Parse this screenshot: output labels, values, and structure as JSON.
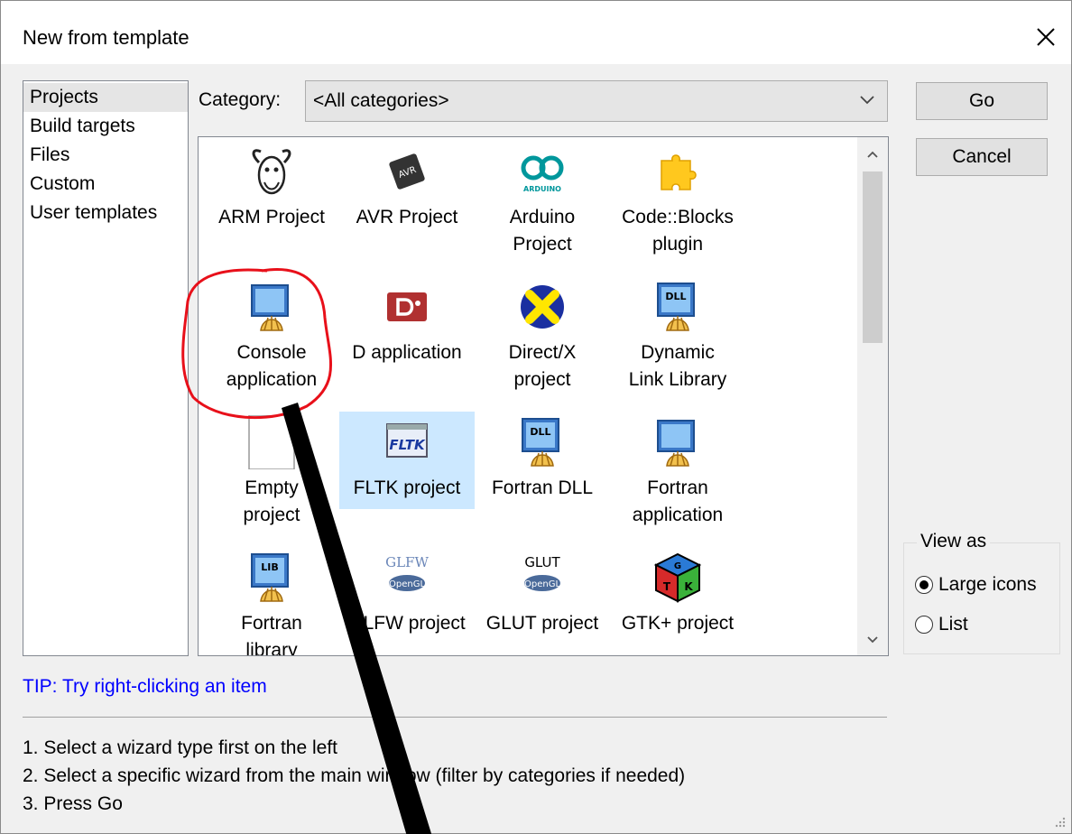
{
  "window": {
    "title": "New from template"
  },
  "sidebar": {
    "items": [
      {
        "label": "Projects",
        "selected": true
      },
      {
        "label": "Build targets"
      },
      {
        "label": "Files"
      },
      {
        "label": "Custom"
      },
      {
        "label": "User templates"
      }
    ]
  },
  "category": {
    "label": "Category:",
    "value": "<All categories>"
  },
  "buttons": {
    "go": "Go",
    "cancel": "Cancel"
  },
  "templates": [
    {
      "line1": "ARM Project",
      "line2": "",
      "icon": "gnu-icon"
    },
    {
      "line1": "AVR Project",
      "line2": "",
      "icon": "avr-chip-icon"
    },
    {
      "line1": "Arduino",
      "line2": "Project",
      "icon": "arduino-icon"
    },
    {
      "line1": "Code::Blocks",
      "line2": "plugin",
      "icon": "puzzle-piece-icon"
    },
    {
      "line1": "Console",
      "line2": "application",
      "icon": "console-app-icon"
    },
    {
      "line1": "D application",
      "line2": "",
      "icon": "d-language-icon"
    },
    {
      "line1": "Direct/X",
      "line2": "project",
      "icon": "directx-icon"
    },
    {
      "line1": "Dynamic",
      "line2": "Link Library",
      "icon": "dll-icon"
    },
    {
      "line1": "Empty",
      "line2": "project",
      "icon": "empty-file-icon"
    },
    {
      "line1": "FLTK project",
      "line2": "",
      "icon": "fltk-icon",
      "selected": true
    },
    {
      "line1": "Fortran DLL",
      "line2": "",
      "icon": "fortran-dll-icon"
    },
    {
      "line1": "Fortran",
      "line2": "application",
      "icon": "fortran-app-icon"
    },
    {
      "line1": "Fortran",
      "line2": "library",
      "icon": "lib-icon"
    },
    {
      "line1": "GLFW project",
      "line2": "",
      "icon": "glfw-opengl-icon"
    },
    {
      "line1": "GLUT project",
      "line2": "",
      "icon": "glut-opengl-icon"
    },
    {
      "line1": "GTK+ project",
      "line2": "",
      "icon": "gtk-cube-icon"
    }
  ],
  "icon_text": {
    "avr": "AVR",
    "arduino": "ARDUINO",
    "dll": "DLL",
    "fltk": "FLTK",
    "lib": "LIB",
    "glfw": "GLFW",
    "glut": "GLUT",
    "opengl": "OpenGL",
    "gtk_g": "G",
    "gtk_t": "T",
    "gtk_k": "K"
  },
  "view_as": {
    "label": "View as",
    "options": [
      {
        "label": "Large icons",
        "checked": true
      },
      {
        "label": "List",
        "checked": false
      }
    ]
  },
  "tip": "TIP: Try right-clicking an item",
  "instructions": [
    "1. Select a wizard type first on the left",
    "2. Select a specific wizard from the main window (filter by categories if needed)",
    "3. Press Go"
  ],
  "colors": {
    "tip": "#0000ff",
    "selection": "#cce8ff",
    "annotation_circle": "#e8101a",
    "annotation_arrow": "#000000"
  }
}
